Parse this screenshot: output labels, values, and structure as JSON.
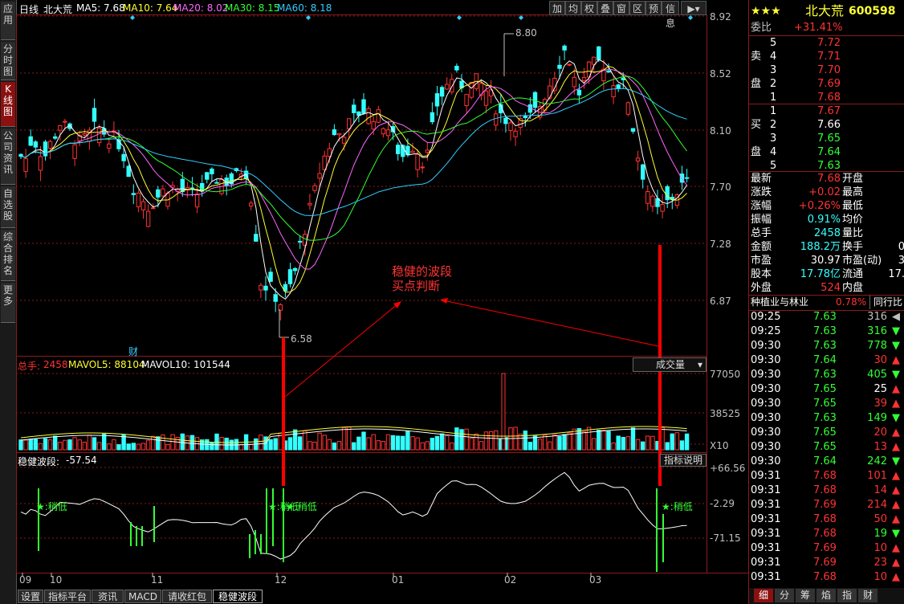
{
  "left_tabs": [
    "应用",
    "分时图",
    "K线图",
    "公司资讯",
    "自选股",
    "综合排名",
    "更多"
  ],
  "header": {
    "period": "日线",
    "stock_name": "北大荒",
    "ma5": "MA5: 7.68",
    "ma10": "MA10: 7.64",
    "ma20": "MA20: 8.02",
    "ma30": "MA30: 8.15",
    "ma60": "MA60: 8.18"
  },
  "toolbar": [
    "加",
    "均",
    "权",
    "叠",
    "窗",
    "区",
    "预",
    "信息"
  ],
  "price_axis": [
    "8.92",
    "8.52",
    "8.10",
    "7.70",
    "7.28",
    "6.87"
  ],
  "high_label": "8.80",
  "low_label": "6.58",
  "cai_label": "财",
  "annotation": "稳健的波段\n买点判断",
  "annotation_line1": "稳健的波段",
  "annotation_line2": "买点判断",
  "volume": {
    "title": "总手:",
    "value": "2458",
    "mavol5": "MAVOL5: 88104",
    "mavol10": "MAVOL10: 101544",
    "dropdown": "成交量",
    "axis": [
      "77050",
      "38525",
      "X10"
    ]
  },
  "indicator": {
    "title": "稳健波段:",
    "value": "-57.54",
    "help": "指标说明",
    "axis": [
      "+66.56",
      "-2.29",
      "-71.15"
    ],
    "signal": "★:稍低"
  },
  "date_axis": [
    "09",
    "10",
    "11",
    "12",
    "01",
    "02",
    "03"
  ],
  "bottom_tabs": [
    "设置",
    "指标平台",
    "资讯",
    "MACD",
    "请收红包",
    "稳健波段"
  ],
  "right_panel": {
    "stars": "★★★",
    "name": "北大荒",
    "code": "600598",
    "weibi_label": "委比",
    "weibi_value": "+31.41%",
    "sell_label": [
      "卖",
      "盘"
    ],
    "buy_label": [
      "买",
      "盘"
    ],
    "asks": [
      {
        "n": "5",
        "p": "7.72"
      },
      {
        "n": "4",
        "p": "7.71"
      },
      {
        "n": "3",
        "p": "7.70"
      },
      {
        "n": "2",
        "p": "7.69"
      },
      {
        "n": "1",
        "p": "7.68"
      }
    ],
    "bids": [
      {
        "n": "1",
        "p": "7.67"
      },
      {
        "n": "2",
        "p": "7.66"
      },
      {
        "n": "3",
        "p": "7.65"
      },
      {
        "n": "4",
        "p": "7.64"
      },
      {
        "n": "5",
        "p": "7.63"
      }
    ],
    "stats": [
      {
        "l": "最新",
        "v": "7.68",
        "l2": "开盘"
      },
      {
        "l": "涨跌",
        "v": "+0.02",
        "l2": "最高"
      },
      {
        "l": "涨幅",
        "v": "+0.26%",
        "l2": "最低"
      },
      {
        "l": "振幅",
        "v": "0.91%",
        "l2": "均价"
      },
      {
        "l": "总手",
        "v": "2458",
        "l2": "量比"
      },
      {
        "l": "金额",
        "v": "188.2万",
        "l2": "换手",
        "v2": "0"
      },
      {
        "l": "市盈",
        "v": "30.97",
        "l2": "市盈(动)",
        "v2": "3"
      },
      {
        "l": "股本",
        "v": "17.78亿",
        "l2": "流通",
        "v2": "17."
      },
      {
        "l": "外盘",
        "v": "524",
        "l2": "内盘"
      }
    ],
    "industry": "种植业与林业",
    "industry_pct": "0.78%",
    "peer_btn": "同行比",
    "ticks": [
      {
        "t": "09:25",
        "p": "7.63",
        "v": "316",
        "d": "gray"
      },
      {
        "t": "09:25",
        "p": "7.63",
        "v": "316",
        "d": "down"
      },
      {
        "t": "09:30",
        "p": "7.63",
        "v": "778",
        "d": "down"
      },
      {
        "t": "09:30",
        "p": "7.64",
        "v": "30",
        "d": "up"
      },
      {
        "t": "09:30",
        "p": "7.63",
        "v": "405",
        "d": "down"
      },
      {
        "t": "09:30",
        "p": "7.65",
        "v": "25",
        "d": "up"
      },
      {
        "t": "09:30",
        "p": "7.65",
        "v": "39",
        "d": "up"
      },
      {
        "t": "09:30",
        "p": "7.63",
        "v": "149",
        "d": "down"
      },
      {
        "t": "09:30",
        "p": "7.65",
        "v": "20",
        "d": "up"
      },
      {
        "t": "09:30",
        "p": "7.65",
        "v": "13",
        "d": "up"
      },
      {
        "t": "09:30",
        "p": "7.64",
        "v": "242",
        "d": "down"
      },
      {
        "t": "09:31",
        "p": "7.68",
        "v": "101",
        "d": "up"
      },
      {
        "t": "09:31",
        "p": "7.68",
        "v": "14",
        "d": "up"
      },
      {
        "t": "09:31",
        "p": "7.69",
        "v": "214",
        "d": "up"
      },
      {
        "t": "09:31",
        "p": "7.68",
        "v": "50",
        "d": "up"
      },
      {
        "t": "09:31",
        "p": "7.68",
        "v": "19",
        "d": "down"
      },
      {
        "t": "09:31",
        "p": "7.69",
        "v": "10",
        "d": "up"
      },
      {
        "t": "09:31",
        "p": "7.69",
        "v": "23",
        "d": "up"
      },
      {
        "t": "09:31",
        "p": "7.68",
        "v": "10",
        "d": "up"
      }
    ],
    "bottom_tabs": [
      "细",
      "分",
      "筹",
      "焰",
      "指",
      "财"
    ]
  },
  "colors": {
    "up": "#ff3333",
    "down": "#33ffff",
    "grid": "#8b1a1a",
    "ma5": "#ffffff",
    "ma10": "#ffff33",
    "ma20": "#ff66ff",
    "ma30": "#33ff33",
    "ma60": "#33ccff"
  }
}
